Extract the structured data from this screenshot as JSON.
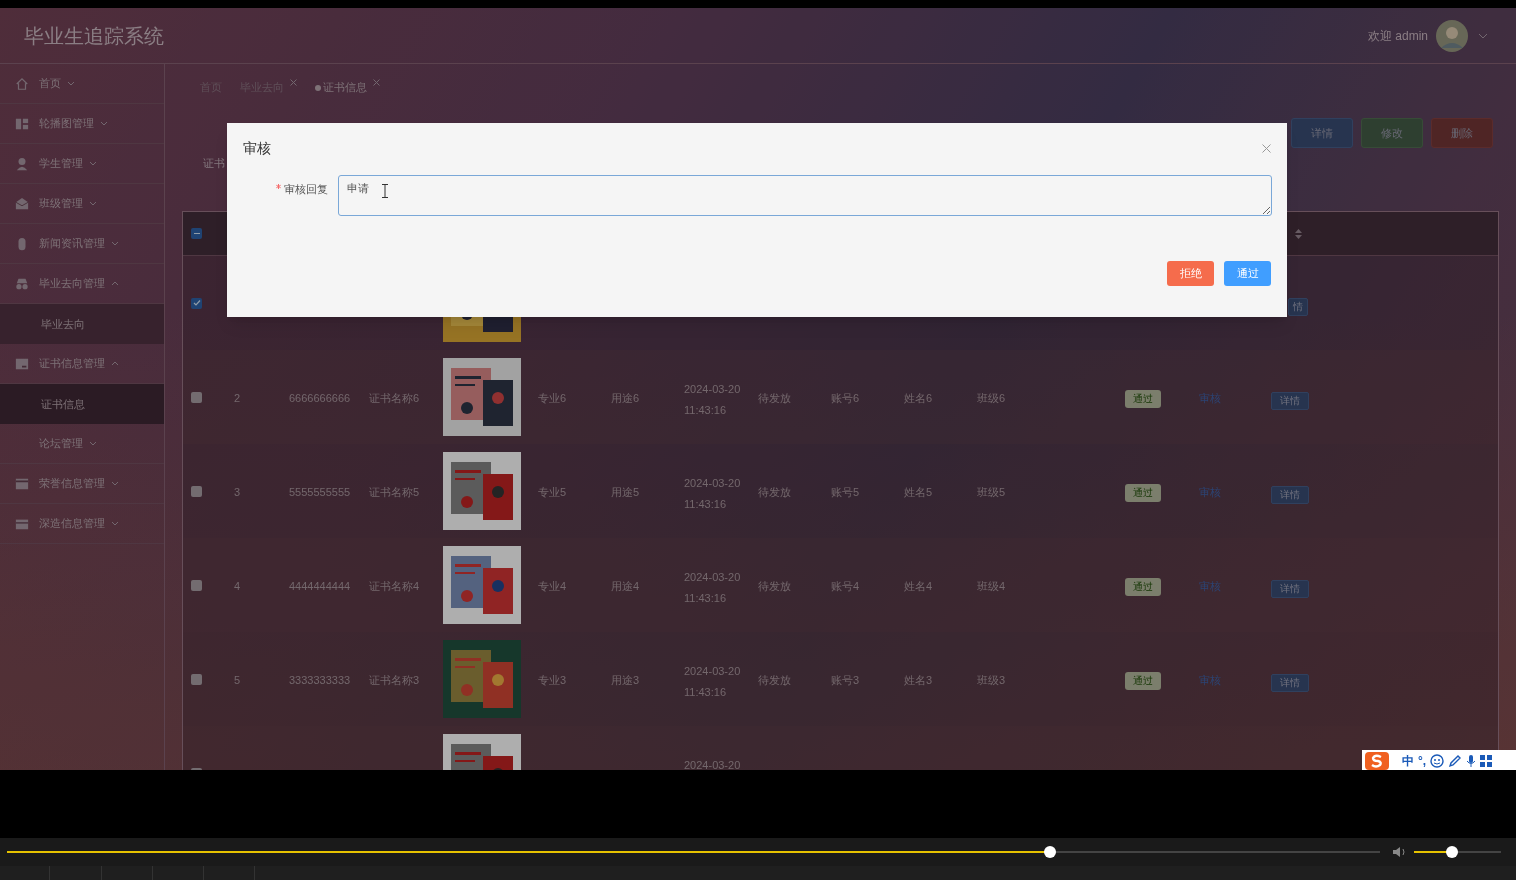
{
  "header": {
    "title": "毕业生追踪系统",
    "welcome": "欢迎 admin"
  },
  "sidebar": {
    "items": [
      {
        "label": "首页",
        "expanded": false
      },
      {
        "label": "轮播图管理",
        "expanded": false
      },
      {
        "label": "学生管理",
        "expanded": false
      },
      {
        "label": "班级管理",
        "expanded": false
      },
      {
        "label": "新闻资讯管理",
        "expanded": false
      },
      {
        "label": "毕业去向管理",
        "expanded": true,
        "children": [
          {
            "label": "毕业去向",
            "selected": false
          }
        ]
      },
      {
        "label": "证书信息管理",
        "expanded": true,
        "children": [
          {
            "label": "证书信息",
            "selected": true
          }
        ]
      },
      {
        "label": "论坛管理",
        "expanded": false
      },
      {
        "label": "荣誉信息管理",
        "expanded": false
      },
      {
        "label": "深造信息管理",
        "expanded": false
      }
    ]
  },
  "tabs": [
    {
      "label": "首页",
      "closable": false,
      "selected": false
    },
    {
      "label": "毕业去向",
      "closable": true,
      "selected": false
    },
    {
      "label": "证书信息",
      "closable": true,
      "selected": true
    }
  ],
  "toolbar": {
    "buttons": [
      {
        "label": "详情",
        "kind": "info"
      },
      {
        "label": "修改",
        "kind": "success"
      },
      {
        "label": "删除",
        "kind": "danger"
      }
    ]
  },
  "search": {
    "label": "证书"
  },
  "table": {
    "header": {
      "indeterminate": true
    },
    "rows": [
      {
        "selected": true,
        "button": "情"
      },
      {
        "selected": false,
        "index": "2",
        "number": "6666666666",
        "name": "证书名称6",
        "major": "专业6",
        "use": "用途6",
        "date": "2024-03-20",
        "time": "11:43:16",
        "status": "待发放",
        "account": "账号6",
        "student": "姓名6",
        "class": "班级6",
        "tag": "通过",
        "link": "审核",
        "button": "详情"
      },
      {
        "selected": false,
        "index": "3",
        "number": "5555555555",
        "name": "证书名称5",
        "major": "专业5",
        "use": "用途5",
        "date": "2024-03-20",
        "time": "11:43:16",
        "status": "待发放",
        "account": "账号5",
        "student": "姓名5",
        "class": "班级5",
        "tag": "通过",
        "link": "审核",
        "button": "详情"
      },
      {
        "selected": false,
        "index": "4",
        "number": "4444444444",
        "name": "证书名称4",
        "major": "专业4",
        "use": "用途4",
        "date": "2024-03-20",
        "time": "11:43:16",
        "status": "待发放",
        "account": "账号4",
        "student": "姓名4",
        "class": "班级4",
        "tag": "通过",
        "link": "审核",
        "button": "详情"
      },
      {
        "selected": false,
        "index": "5",
        "number": "3333333333",
        "name": "证书名称3",
        "major": "专业3",
        "use": "用途3",
        "date": "2024-03-20",
        "time": "11:43:16",
        "status": "待发放",
        "account": "账号3",
        "student": "姓名3",
        "class": "班级3",
        "tag": "通过",
        "link": "审核",
        "button": "详情"
      },
      {
        "selected": false,
        "date": "2024-03-20"
      }
    ]
  },
  "dialog": {
    "title": "审核",
    "field": {
      "label": "审核回复",
      "required": true,
      "value": "申请"
    },
    "buttons": [
      {
        "label": "拒绝",
        "kind": "danger"
      },
      {
        "label": "通过",
        "kind": "primary"
      }
    ]
  },
  "ime": {
    "items": [
      "中",
      "°,"
    ]
  },
  "player": {
    "progress": {
      "level": 0.76
    },
    "volume": {
      "level": 0.44
    }
  }
}
